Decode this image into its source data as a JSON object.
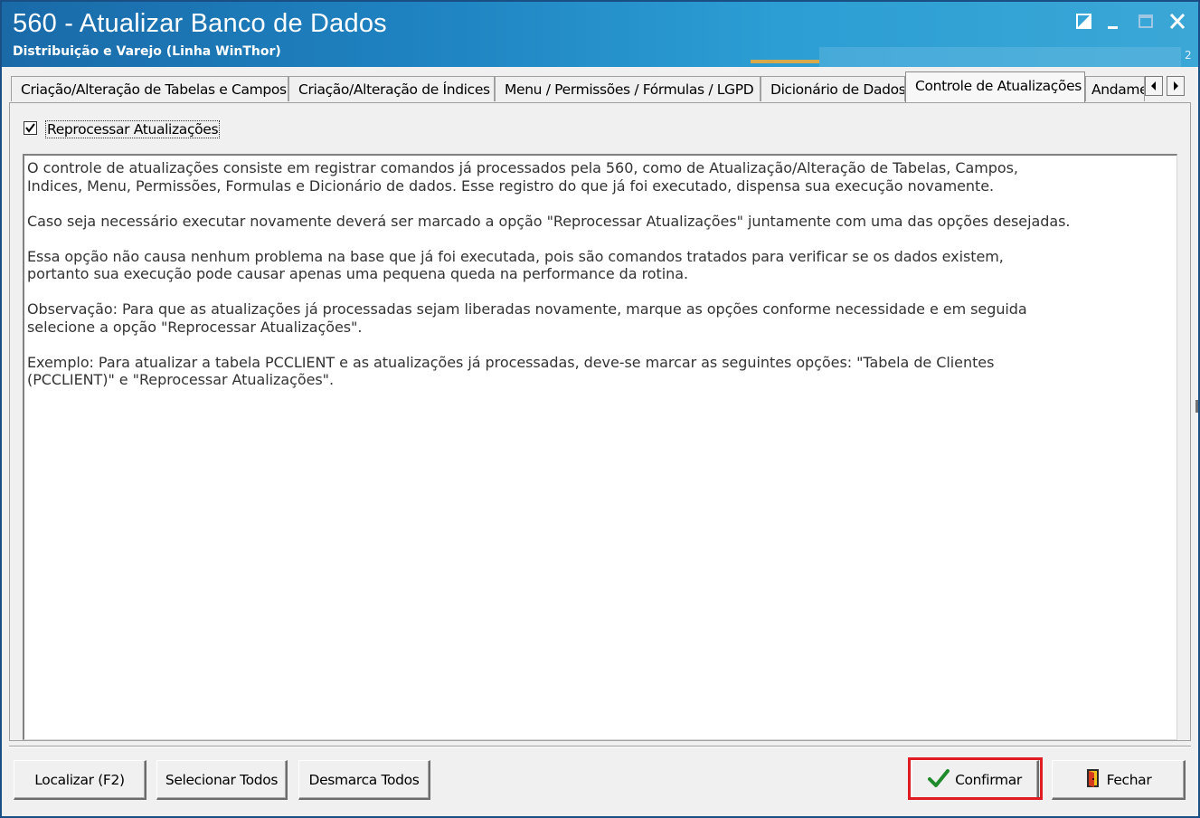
{
  "window": {
    "title": "560 - Atualizar Banco de Dados",
    "subtitle": "Distribuição e Varejo (Linha WinThor)",
    "corner_glyph": "2",
    "controls": [
      "restore-icon",
      "minimize-icon",
      "maximize-icon",
      "close-icon"
    ]
  },
  "tabs": [
    {
      "label": "Criação/Alteração de Tabelas e Campos",
      "active": false
    },
    {
      "label": "Criação/Alteração de Índices",
      "active": false
    },
    {
      "label": "Menu / Permissões / Fórmulas / LGPD",
      "active": false
    },
    {
      "label": "Dicionário de Dados",
      "active": false
    },
    {
      "label": "Controle de Atualizações",
      "active": true
    },
    {
      "label": "Andame",
      "active": false
    }
  ],
  "reprocess": {
    "label": "Reprocessar Atualizações",
    "checked": true
  },
  "memo": {
    "paragraphs": [
      "O controle de atualizações consiste em registrar comandos já processados pela 560, como de Atualização/Alteração de Tabelas, Campos,\nIndices, Menu, Permissões, Formulas e Dicionário de dados. Esse registro do que já foi executado, dispensa sua execução novamente.",
      "Caso seja necessário executar novamente deverá ser marcado a opção \"Reprocessar Atualizações\" juntamente com uma das opções desejadas.",
      "Essa opção não causa nenhum problema na base que já foi executada, pois são comandos tratados para verificar se os dados existem,\nportanto sua execução pode causar apenas uma pequena queda na performance da rotina.",
      "Observação: Para que as atualizações já processadas sejam liberadas novamente, marque as opções conforme necessidade e em seguida\nselecione a opção \"Reprocessar Atualizações\".",
      "Exemplo: Para atualizar a tabela PCCLIENT e as atualizações já processadas, deve-se marcar as seguintes opções: \"Tabela de Clientes\n(PCCLIENT)\" e \"Reprocessar Atualizações\"."
    ]
  },
  "buttons": {
    "localizar": "Localizar (F2)",
    "selecionar_todos": "Selecionar Todos",
    "desmarca_todos": "Desmarca Todos",
    "confirmar": "Confirmar",
    "fechar": "Fechar"
  },
  "colors": {
    "titlebar": "#1f83c1",
    "highlight": "#e01b22",
    "confirm_check": "#1f8a2b"
  }
}
